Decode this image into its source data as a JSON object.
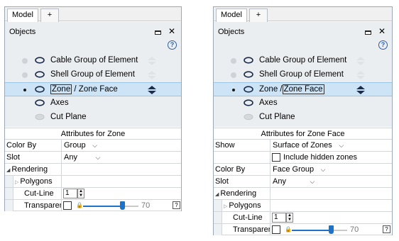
{
  "left": {
    "tabs": {
      "model": "Model",
      "add": "+"
    },
    "objects_title": "Objects",
    "help": "?",
    "items": [
      {
        "label": "Cable Group of Element"
      },
      {
        "label": "Shell Group of Element"
      },
      {
        "label_a": "Zone",
        "label_b": "/ Zone Face"
      },
      {
        "label": "Axes"
      },
      {
        "label": "Cut Plane"
      }
    ],
    "attributes_title": "Attributes for Zone",
    "props": {
      "color_by": {
        "label": "Color By",
        "value": "Group"
      },
      "slot": {
        "label": "Slot",
        "value": "Any"
      },
      "rendering": {
        "label": "Rendering"
      },
      "polygons": {
        "label": "Polygons"
      },
      "cut_line": {
        "label": "Cut-Line",
        "value": "1"
      },
      "transparency": {
        "label": "Transparency",
        "value": "70",
        "level_percent": 70
      }
    }
  },
  "right": {
    "tabs": {
      "model": "Model",
      "add": "+"
    },
    "objects_title": "Objects",
    "help": "?",
    "items": [
      {
        "label": "Cable Group of Element"
      },
      {
        "label": "Shell Group of Element"
      },
      {
        "label_a": "Zone /",
        "label_b": "Zone Face"
      },
      {
        "label": "Axes"
      },
      {
        "label": "Cut Plane"
      }
    ],
    "attributes_title": "Attributes for Zone Face",
    "props": {
      "show": {
        "label": "Show",
        "value": "Surface of Zones"
      },
      "include_hidden": {
        "label": "Include hidden zones"
      },
      "color_by": {
        "label": "Color By",
        "value": "Face Group"
      },
      "slot": {
        "label": "Slot",
        "value": "Any"
      },
      "rendering": {
        "label": "Rendering"
      },
      "polygons": {
        "label": "Polygons"
      },
      "cut_line": {
        "label": "Cut-Line",
        "value": "1"
      },
      "transparency": {
        "label": "Transparency",
        "value": "70",
        "level_percent": 70
      }
    }
  },
  "colors": {
    "selection": "#cde4f7",
    "accent": "#1e73c8",
    "panel_bg": "#ebeef1"
  },
  "icons": [
    "eye-icon",
    "updown-arrows-icon",
    "minimize-icon",
    "close-icon",
    "help-icon",
    "lock-icon"
  ]
}
